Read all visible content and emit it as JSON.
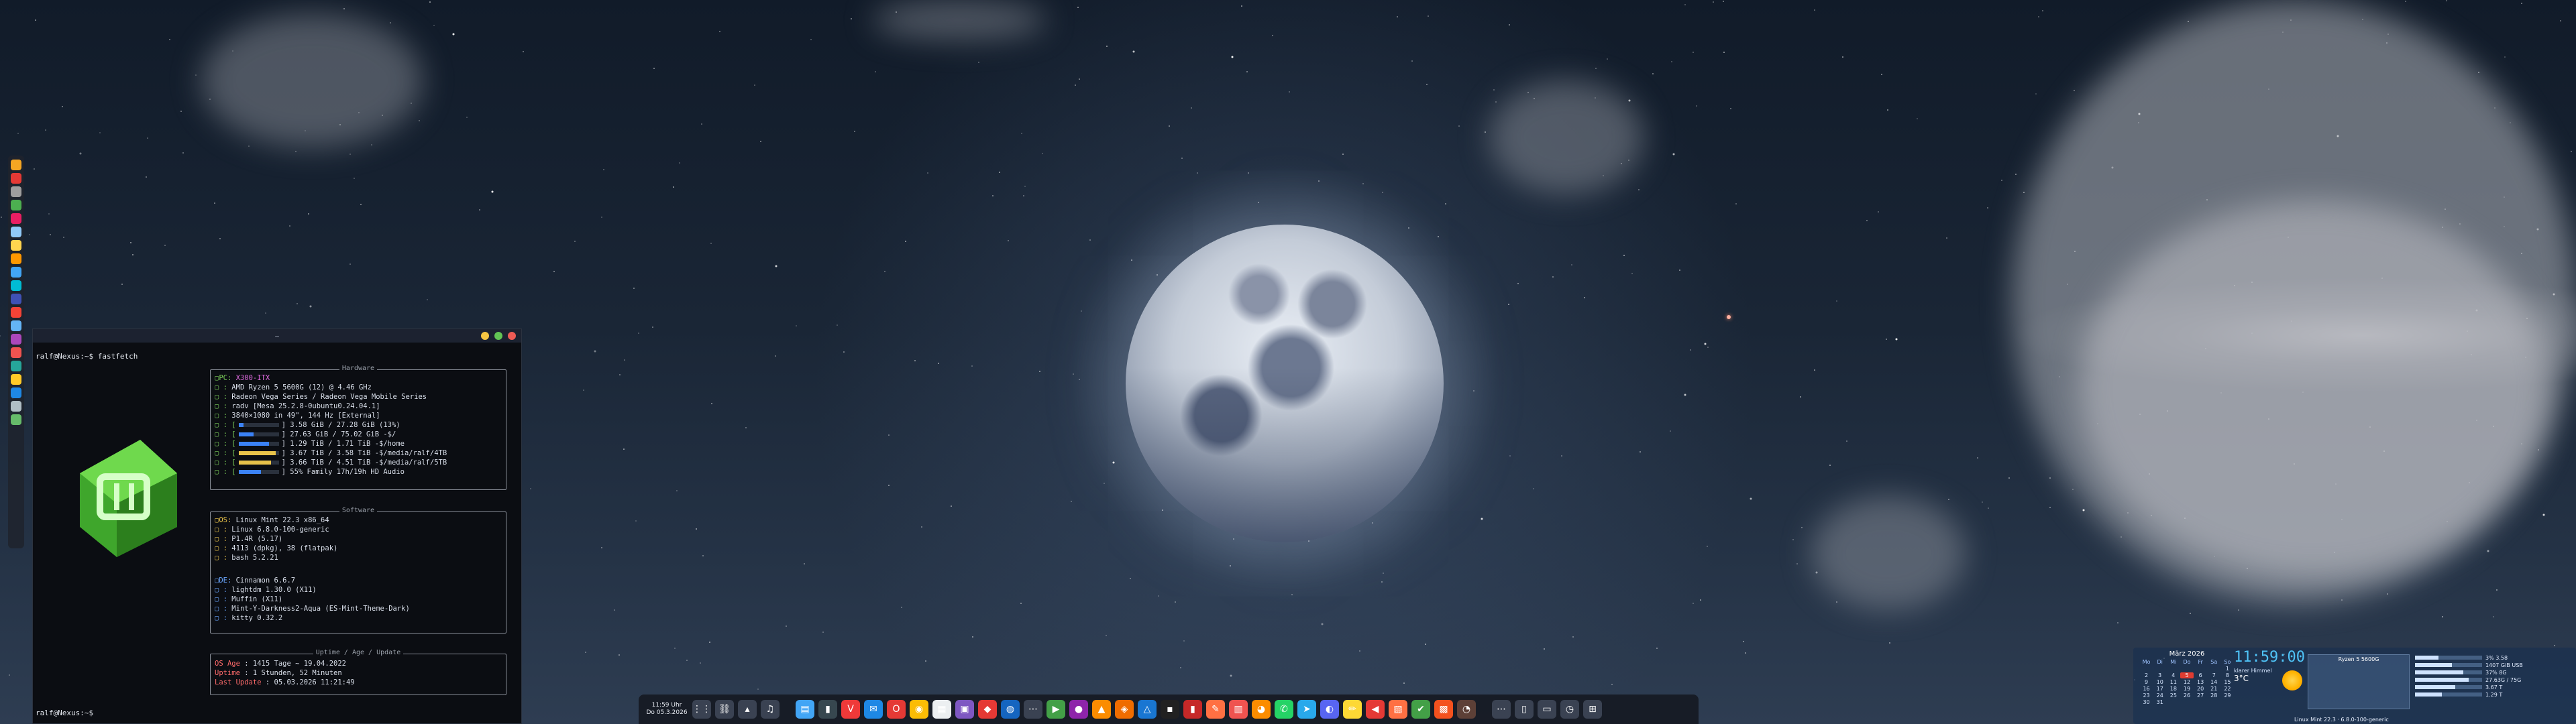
{
  "desktop": {
    "wallpaper": "moon-night-sky"
  },
  "left_dock": {
    "items": [
      {
        "icon": "app-icon-1",
        "color": "#f5a623"
      },
      {
        "icon": "app-icon-2",
        "color": "#e53935"
      },
      {
        "icon": "app-icon-3",
        "color": "#9e9e9e"
      },
      {
        "icon": "app-icon-4",
        "color": "#4caf50"
      },
      {
        "icon": "app-icon-5",
        "color": "#e91e63"
      },
      {
        "icon": "app-icon-6",
        "color": "#90caf9"
      },
      {
        "icon": "moon-icon",
        "color": "#ffd54f"
      },
      {
        "icon": "app-icon-8",
        "color": "#ff9800"
      },
      {
        "icon": "app-icon-9",
        "color": "#42a5f5"
      },
      {
        "icon": "app-icon-10",
        "color": "#00bcd4"
      },
      {
        "icon": "app-icon-11",
        "color": "#3f51b5"
      },
      {
        "icon": "app-icon-12",
        "color": "#f44336"
      },
      {
        "icon": "app-icon-13",
        "color": "#64b5f6"
      },
      {
        "icon": "app-icon-14",
        "color": "#ab47bc"
      },
      {
        "icon": "app-icon-15",
        "color": "#ef5350"
      },
      {
        "icon": "app-icon-16",
        "color": "#26a69a"
      },
      {
        "icon": "app-icon-17",
        "color": "#ffca28"
      },
      {
        "icon": "app-icon-18",
        "color": "#1e88e5"
      },
      {
        "icon": "app-icon-19",
        "color": "#b0bec5"
      },
      {
        "icon": "app-icon-20",
        "color": "#66bb6a"
      }
    ]
  },
  "terminal": {
    "title": "~",
    "prompt_top": "ralf@Nexus:~$ fastfetch",
    "prompt_bottom": "ralf@Nexus:~$ ",
    "hardware": {
      "title": "Hardware",
      "pc": "X300-ITX",
      "cpu": "AMD Ryzen 5 5600G (12) @ 4.46 GHz",
      "gpu": "Radeon Vega Series / Radeon Vega Mobile Series",
      "driver": "radv [Mesa 25.2.8-0ubuntu0.24.04.1]",
      "display": "3840×1080 in 49\", 144 Hz [External]",
      "mem": "3.58 GiB / 27.28 GiB (13%)",
      "disk1": "27.63 GiB / 75.02 GiB -$/",
      "disk2": "1.29 TiB / 1.71 TiB -$/home",
      "disk3": "3.67 TiB / 3.58 TiB -$/media/ralf/4TB",
      "disk4": "3.66 TiB / 4.51 TiB -$/media/ralf/5TB",
      "audio": "55% Family 17h/19h HD Audio"
    },
    "software": {
      "title": "Software",
      "os": "Linux Mint 22.3 x86_64",
      "kernel": "Linux 6.8.0-100-generic",
      "shell_ver": "P1.4R (5.17)",
      "packages": "4113 (dpkg), 38 (flatpak)",
      "shell": "bash 5.2.21",
      "de": "Cinnamon 6.6.7",
      "dm": "lightdm 1.30.0 (X11)",
      "wm": "Muffin (X11)",
      "theme": "Mint-Y-Darkness2-Aqua (ES-Mint-Theme-Dark)",
      "term": "kitty 0.32.2"
    },
    "uptime": {
      "title": "Uptime / Age / Update",
      "age_label": "OS Age",
      "age": ": 1415 Tage ~ 19.04.2022",
      "uptime_label": "Uptime",
      "uptime": ": 1 Stunden, 52 Minuten",
      "update_label": "Last Update",
      "update": ": 05.03.2026 11:21:49"
    }
  },
  "taskbar": {
    "clock_time": "11:59 Uhr",
    "clock_date": "Do 05.3.2026",
    "icons": [
      {
        "name": "menu-grid-icon",
        "color": "#3a4252",
        "glyph": "⋮⋮"
      },
      {
        "name": "network-icon",
        "color": "#3a4252",
        "glyph": "⛓"
      },
      {
        "name": "tray-up-icon",
        "color": "#3a4252",
        "glyph": "▴"
      },
      {
        "name": "audio-icon",
        "color": "#3a4252",
        "glyph": "♫"
      },
      {
        "name": "folder-icon",
        "color": "#42a5f5",
        "glyph": "▤"
      },
      {
        "name": "terminal-icon",
        "color": "#37474f",
        "glyph": "▮"
      },
      {
        "name": "vivaldi-icon",
        "color": "#ef3939",
        "glyph": "V"
      },
      {
        "name": "mail-icon",
        "color": "#1e88e5",
        "glyph": "✉"
      },
      {
        "name": "opera-icon",
        "color": "#e53935",
        "glyph": "O"
      },
      {
        "name": "chrome-icon",
        "color": "#fbbc05",
        "glyph": "◉"
      },
      {
        "name": "notes-icon",
        "color": "#eceff1",
        "glyph": "▦"
      },
      {
        "name": "app-purple-icon",
        "color": "#7e57c2",
        "glyph": "▣"
      },
      {
        "name": "app-red-icon",
        "color": "#e53935",
        "glyph": "◆"
      },
      {
        "name": "app-blue-icon",
        "color": "#1565c0",
        "glyph": "◍"
      },
      {
        "name": "dots-icon",
        "color": "#3a4252",
        "glyph": "⋯"
      },
      {
        "name": "play-icon",
        "color": "#43a047",
        "glyph": "▶"
      },
      {
        "name": "media-icon",
        "color": "#8e24aa",
        "glyph": "●"
      },
      {
        "name": "vlc-icon",
        "color": "#fb8c00",
        "glyph": "▲"
      },
      {
        "name": "app-orange-icon",
        "color": "#ef6c00",
        "glyph": "◈"
      },
      {
        "name": "app-nav-icon",
        "color": "#1976d2",
        "glyph": "△"
      },
      {
        "name": "app-dark-icon",
        "color": "#212121",
        "glyph": "▪"
      },
      {
        "name": "app-red2-icon",
        "color": "#c62828",
        "glyph": "▮"
      },
      {
        "name": "app-feather-icon",
        "color": "#ff7043",
        "glyph": "✎"
      },
      {
        "name": "app-book-icon",
        "color": "#ef5350",
        "glyph": "▥"
      },
      {
        "name": "app-cat-icon",
        "color": "#fb8c00",
        "glyph": "◕"
      },
      {
        "name": "whatsapp-icon",
        "color": "#25d366",
        "glyph": "✆"
      },
      {
        "name": "telegram-icon",
        "color": "#29a9eb",
        "glyph": "➤"
      },
      {
        "name": "discord-icon",
        "color": "#5865f2",
        "glyph": "◐"
      },
      {
        "name": "pen-icon",
        "color": "#fdd835",
        "glyph": "✏"
      },
      {
        "name": "app-red3-icon",
        "color": "#e53935",
        "glyph": "◀"
      },
      {
        "name": "app-bag-icon",
        "color": "#ff7043",
        "glyph": "▧"
      },
      {
        "name": "app-green-icon",
        "color": "#43a047",
        "glyph": "✔"
      },
      {
        "name": "app-orange2-icon",
        "color": "#f4511e",
        "glyph": "▩"
      },
      {
        "name": "app-cat2-icon",
        "color": "#5d4037",
        "glyph": "◔"
      },
      {
        "name": "tray-menu-icon",
        "color": "#3a4252",
        "glyph": "⋯"
      },
      {
        "name": "tray-clipboard-icon",
        "color": "#3a4252",
        "glyph": "▯"
      },
      {
        "name": "tray-display-icon",
        "color": "#3a4252",
        "glyph": "▭"
      },
      {
        "name": "tray-clock-icon",
        "color": "#3a4252",
        "glyph": "◷"
      },
      {
        "name": "tray-grid-icon",
        "color": "#3a4252",
        "glyph": "⊞"
      }
    ]
  },
  "conky": {
    "calendar_title": "März 2026",
    "weekdays": [
      "Mo",
      "Di",
      "Mi",
      "Do",
      "Fr",
      "Sa",
      "So"
    ],
    "days": [
      "",
      "",
      "",
      "",
      "",
      "",
      "1",
      "2",
      "3",
      "4",
      "5",
      "6",
      "7",
      "8",
      "9",
      "10",
      "11",
      "12",
      "13",
      "14",
      "15",
      "16",
      "17",
      "18",
      "19",
      "20",
      "21",
      "22",
      "23",
      "24",
      "25",
      "26",
      "27",
      "28",
      "29",
      "30",
      "31"
    ],
    "today": "5",
    "time": "11:59:00",
    "weather_label": "klarer Himmel",
    "temp": "3°C",
    "cpu_label": "Ryzen 5 5600G",
    "mem_fill": [
      0.35,
      0.55,
      0.72,
      0.8,
      0.6,
      0.4
    ],
    "disk_lines": [
      "3% 3.58",
      "1407 GiB USB",
      "37% 8G",
      "27.63G / 75G",
      "3.67 T",
      "1.29 T"
    ],
    "sysinfo": "Linux Mint 22.3 · 6.8.0-100-generic"
  }
}
